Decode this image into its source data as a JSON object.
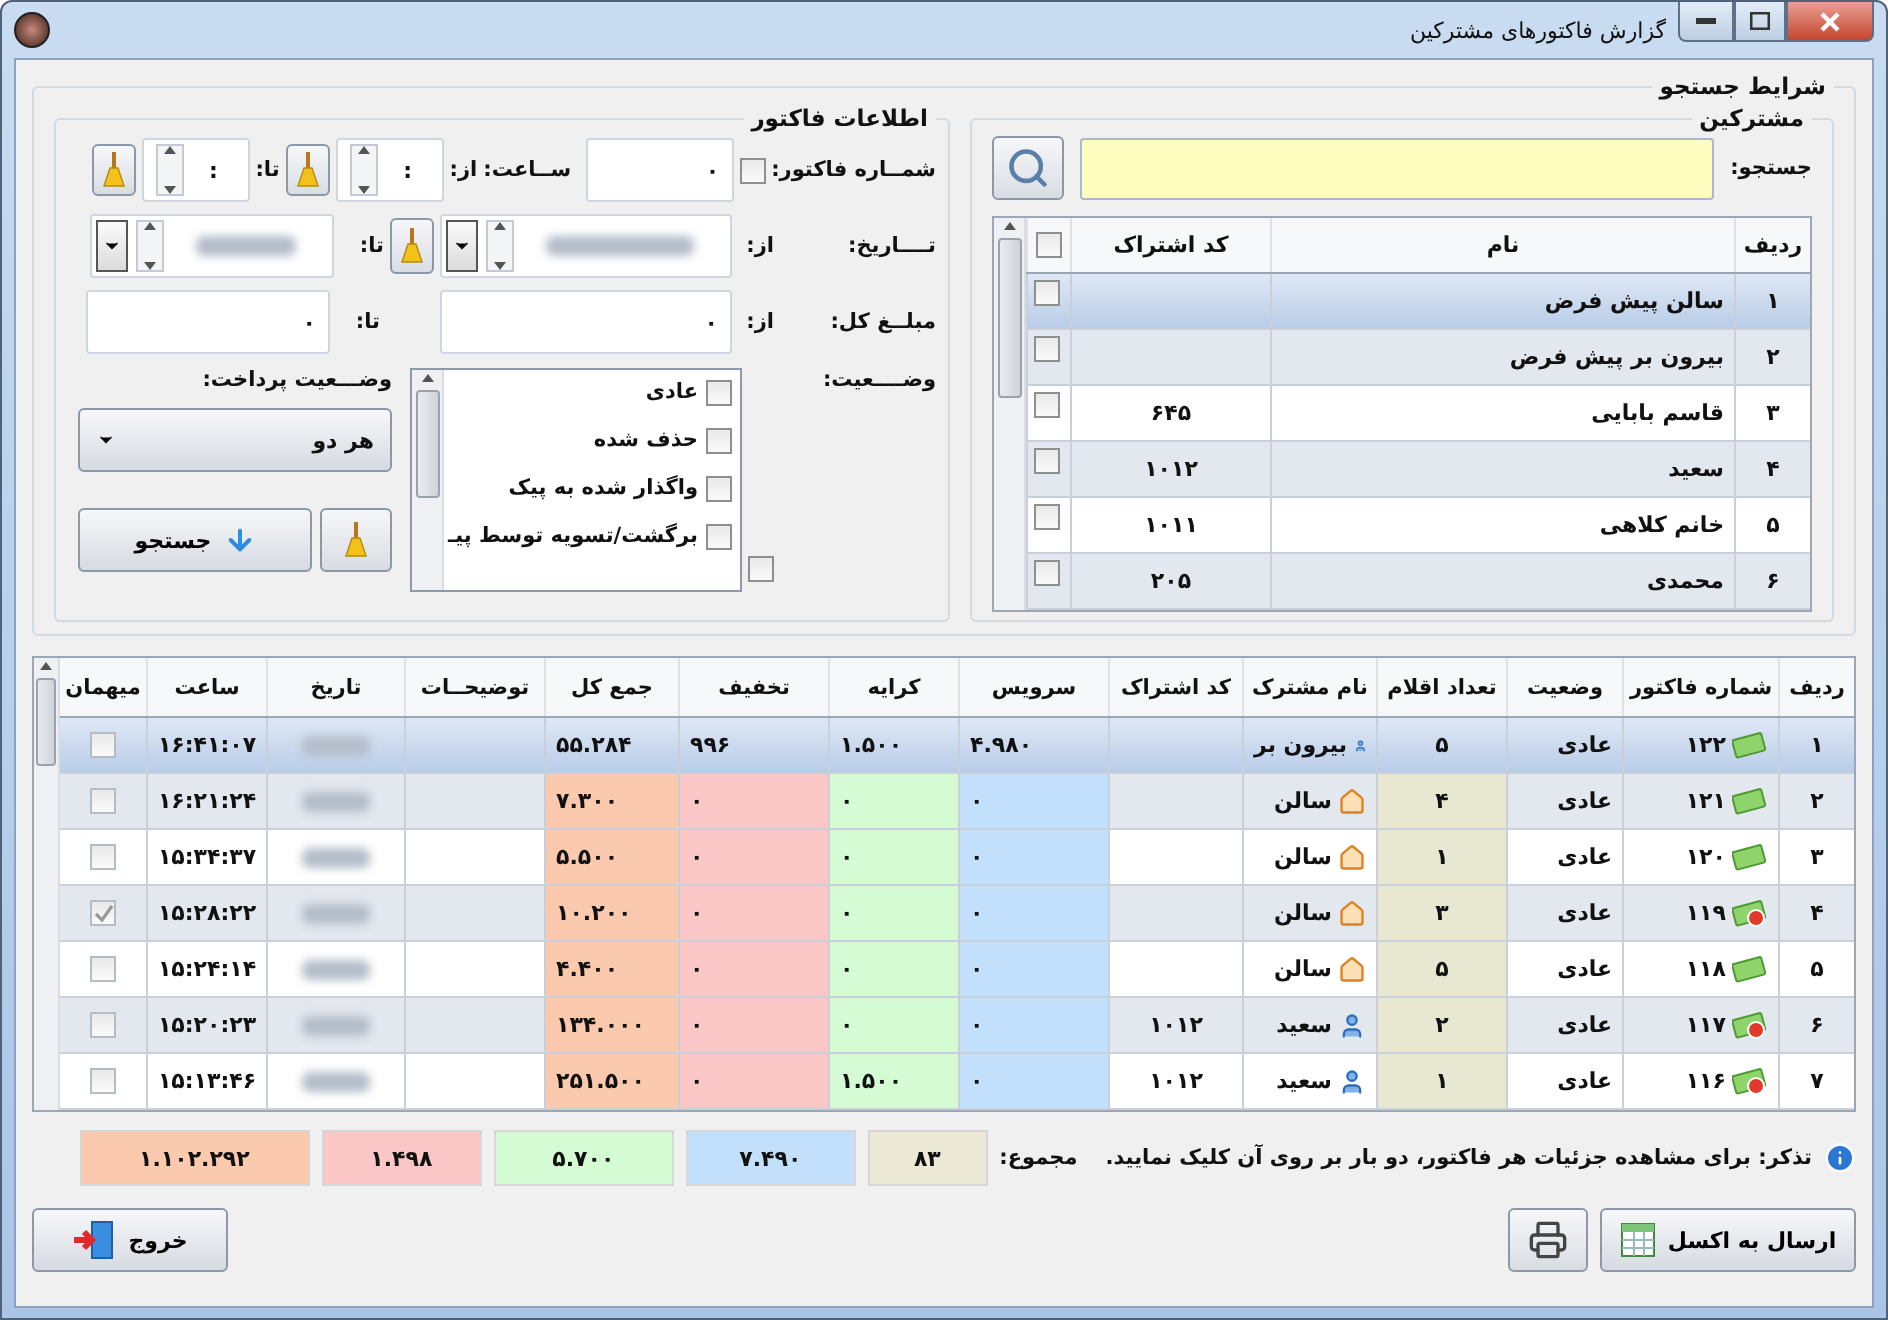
{
  "window": {
    "title": "گزارش فاکتورهای مشترکین"
  },
  "search_conditions": {
    "title": "شرایط جستجو",
    "customers": {
      "title": "مشترکین",
      "search_label": "جستجو:",
      "columns": [
        "ردیف",
        "نام",
        "کد اشتراک"
      ],
      "select_all": false,
      "rows": [
        {
          "row": "۱",
          "name": "سالن پیش فرض",
          "checked": false,
          "selected": true
        },
        {
          "row": "۲",
          "name": "بیرون بر پیش فرض",
          "checked": false,
          "selected": false
        },
        {
          "row": "۳",
          "name": "قاسم بابایی",
          "code": "۶۴۵",
          "checked": false,
          "selected": false
        },
        {
          "row": "۴",
          "name": "سعید",
          "code": "۱۰۱۲",
          "checked": false,
          "selected": false
        },
        {
          "row": "۵",
          "name": "خانم کلاهی",
          "code": "۱۰۱۱",
          "checked": false,
          "selected": false
        },
        {
          "row": "۶",
          "name": "محمدی",
          "code": "۲۰۵",
          "checked": false,
          "selected": false
        }
      ]
    },
    "invoice_info": {
      "title": "اطلاعات فاکتور",
      "invoice_number": {
        "label": "شمــاره فاکتور:",
        "checked": false,
        "value": "۰"
      },
      "time": {
        "label": "ســاعت:",
        "from_label": "از:",
        "from_value": ":",
        "to_label": "تا:",
        "to_value": ":"
      },
      "date": {
        "label": "تــــاریخ:",
        "from_label": "از:",
        "to_label": "تا:"
      },
      "amount": {
        "label": "مبلــغ کل:",
        "from_label": "از:",
        "from_value": "۰",
        "to_label": "تا:",
        "to_value": "۰"
      },
      "status": {
        "label": "وضــــعیت:",
        "all_checked": false,
        "options": [
          {
            "label": "عادی",
            "checked": false
          },
          {
            "label": "حذف شده",
            "checked": false
          },
          {
            "label": "واگذار شده به پیک",
            "checked": false
          },
          {
            "label": "برگشت/تسویه توسط پیـ",
            "checked": false
          }
        ]
      },
      "payment_status": {
        "label": "وضـــعیت پرداخت:",
        "value": "هر دو"
      },
      "search_button": "جستجو"
    }
  },
  "table": {
    "columns": [
      "ردیف",
      "شماره فاکتور",
      "وضعیت",
      "تعداد اقلام",
      "نام مشترک",
      "کد اشتراک",
      "سرویس",
      "کرایه",
      "تخفیف",
      "جمع کل",
      "توضیحــات",
      "تاریخ",
      "ساعت",
      "میهمان"
    ],
    "rows": [
      {
        "row": "۱",
        "number": "۱۲۲",
        "paid": true,
        "status": "عادی",
        "items": "۵",
        "customer": "بیرون بر",
        "kind": "person",
        "service": "۴.۹۸۰",
        "fare": "۱.۵۰۰",
        "discount": "۹۹۶",
        "total": "۵۵.۲۸۴",
        "time": "۱۶:۴۱:۰۷",
        "guest": false,
        "selected": true
      },
      {
        "row": "۲",
        "number": "۱۲۱",
        "paid": true,
        "status": "عادی",
        "items": "۴",
        "customer": "سالن",
        "kind": "house",
        "service": "۰",
        "fare": "۰",
        "discount": "۰",
        "total": "۷.۳۰۰",
        "time": "۱۶:۲۱:۲۴",
        "guest": false,
        "selected": false
      },
      {
        "row": "۳",
        "number": "۱۲۰",
        "paid": true,
        "status": "عادی",
        "items": "۱",
        "customer": "سالن",
        "kind": "house",
        "service": "۰",
        "fare": "۰",
        "discount": "۰",
        "total": "۵.۵۰۰",
        "time": "۱۵:۳۴:۳۷",
        "guest": false,
        "selected": false
      },
      {
        "row": "۴",
        "number": "۱۱۹",
        "paid": false,
        "status": "عادی",
        "items": "۳",
        "customer": "سالن",
        "kind": "house",
        "service": "۰",
        "fare": "۰",
        "discount": "۰",
        "total": "۱۰.۲۰۰",
        "time": "۱۵:۲۸:۲۲",
        "guest": true,
        "selected": false
      },
      {
        "row": "۵",
        "number": "۱۱۸",
        "paid": true,
        "status": "عادی",
        "items": "۵",
        "customer": "سالن",
        "kind": "house",
        "service": "۰",
        "fare": "۰",
        "discount": "۰",
        "total": "۴.۴۰۰",
        "time": "۱۵:۲۴:۱۴",
        "guest": false,
        "selected": false
      },
      {
        "row": "۶",
        "number": "۱۱۷",
        "paid": false,
        "status": "عادی",
        "items": "۲",
        "customer": "سعید",
        "kind": "person",
        "code": "۱۰۱۲",
        "service": "۰",
        "fare": "۰",
        "discount": "۰",
        "total": "۱۳۴.۰۰۰",
        "time": "۱۵:۲۰:۲۳",
        "guest": false,
        "selected": false
      },
      {
        "row": "۷",
        "number": "۱۱۶",
        "paid": false,
        "status": "عادی",
        "items": "۱",
        "customer": "سعید",
        "kind": "person",
        "code": "۱۰۱۲",
        "service": "۰",
        "fare": "۱.۵۰۰",
        "discount": "۰",
        "total": "۲۵۱.۵۰۰",
        "time": "۱۵:۱۳:۴۶",
        "guest": false,
        "selected": false
      }
    ]
  },
  "note": "تذکر: برای مشاهده جزئیات هر فاکتور، دو بار بر روی آن کلیک نمایید.",
  "totals": {
    "label": "مجموع:",
    "values": [
      {
        "value": "۸۳",
        "color": "#ecead6"
      },
      {
        "value": "۷.۴۹۰",
        "color": "#c2e0fb"
      },
      {
        "value": "۵.۷۰۰",
        "color": "#d4fbd4"
      },
      {
        "value": "۱.۴۹۸",
        "color": "#fbc6c6"
      },
      {
        "value": "۱.۱۰۲.۲۹۲",
        "color": "#fbcaae"
      }
    ]
  },
  "buttons": {
    "excel": "ارسال به اکسل",
    "exit": "خروج"
  }
}
